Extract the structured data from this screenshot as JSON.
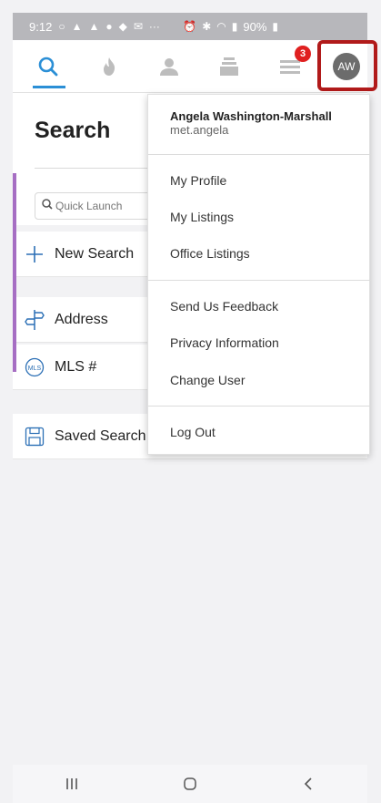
{
  "status_bar": {
    "time": "9:12",
    "battery": "90%"
  },
  "nav": {
    "items": [
      {
        "name": "search-tab",
        "icon": "search-icon"
      },
      {
        "name": "hot-tab",
        "icon": "flame-icon"
      },
      {
        "name": "contacts-tab",
        "icon": "person-icon"
      },
      {
        "name": "listings-tab",
        "icon": "stack-icon"
      },
      {
        "name": "menu-tab",
        "icon": "menu-icon"
      }
    ],
    "notification_count": "3",
    "avatar_initials": "AW",
    "active_color": "#2b8fd6",
    "highlight_color": "#b11a1a"
  },
  "page": {
    "title": "Search",
    "quick_launch_placeholder": "Quick Launch"
  },
  "rows": [
    {
      "label": "New Search",
      "icon": "plus-icon"
    },
    {
      "label": "Address",
      "icon": "signpost-icon"
    },
    {
      "label": "MLS #",
      "icon": "mls-badge-icon",
      "icon_text": "MLS"
    },
    {
      "label": "Saved Search",
      "icon": "saved-icon"
    }
  ],
  "menu": {
    "user_name": "Angela Washington-Marshall",
    "user_id": "met.angela",
    "items_group1": [
      "My Profile",
      "My Listings",
      "Office Listings"
    ],
    "items_group2": [
      "Send Us Feedback",
      "Privacy Information",
      "Change User"
    ],
    "items_group3": [
      "Log Out"
    ]
  },
  "accent_colors": {
    "sidebar_indicator": "#a66ec3",
    "badge": "#e02020"
  }
}
